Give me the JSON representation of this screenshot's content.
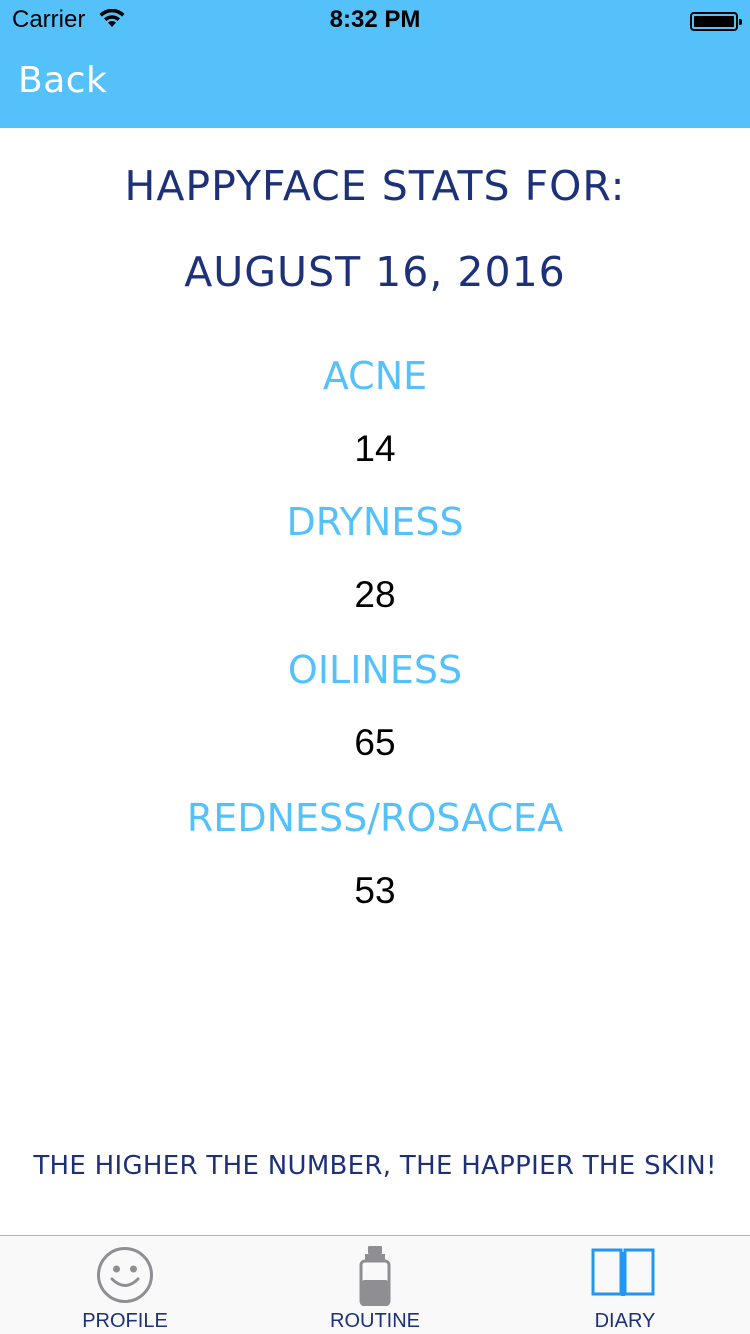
{
  "status_bar": {
    "carrier": "Carrier",
    "time": "8:32 PM"
  },
  "nav": {
    "back_label": "Back"
  },
  "page": {
    "title_line1": "HAPPYFACE STATS FOR:",
    "title_line2": "AUGUST 16, 2016"
  },
  "stats": [
    {
      "label": "ACNE",
      "value": "14"
    },
    {
      "label": "DRYNESS",
      "value": "28"
    },
    {
      "label": "OILINESS",
      "value": "65"
    },
    {
      "label": "REDNESS/ROSACEA",
      "value": "53"
    }
  ],
  "footer_note": "THE HIGHER THE NUMBER, THE HAPPIER THE SKIN!",
  "tabs": [
    {
      "label": "PROFILE",
      "icon": "smiley-icon",
      "selected": false
    },
    {
      "label": "ROUTINE",
      "icon": "bottle-icon",
      "selected": false
    },
    {
      "label": "DIARY",
      "icon": "book-icon",
      "selected": true
    }
  ],
  "colors": {
    "accent": "#54c1fb",
    "title_navy": "#1d3178",
    "tab_icon_inactive": "#8e8e93"
  }
}
